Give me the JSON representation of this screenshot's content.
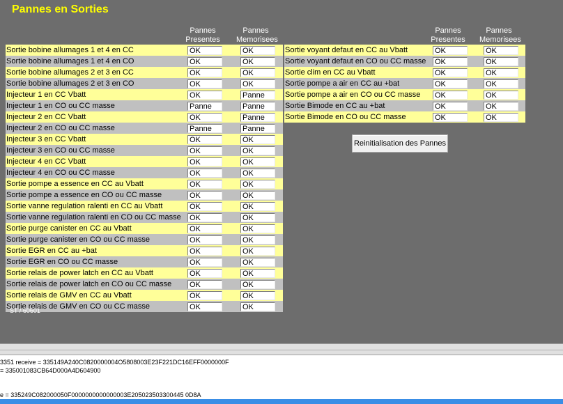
{
  "title": "Pannes en Sorties",
  "headers": {
    "present": [
      "Pannes",
      "Presentes"
    ],
    "memorised": [
      "Pannes",
      "Memorisees"
    ]
  },
  "colors": {
    "label_yellow": "#ffff99",
    "label_gray": "#c0c0c0",
    "title": "#ffff00"
  },
  "left_rows": [
    {
      "label": "Sortie bobine allumages 1 et 4 en CC",
      "present": "OK",
      "memorised": "OK"
    },
    {
      "label": "Sortie bobine allumages 1 et 4 en CO",
      "present": "OK",
      "memorised": "OK"
    },
    {
      "label": "Sortie bobine allumages 2 et 3 en CC",
      "present": "OK",
      "memorised": "OK"
    },
    {
      "label": "Sortie bobine allumages 2 et 3 en CO",
      "present": "OK",
      "memorised": "OK"
    },
    {
      "label": "Injecteur 1 en CC Vbatt",
      "present": "OK",
      "memorised": "Panne"
    },
    {
      "label": "Injecteur 1 en CO ou CC masse",
      "present": "Panne",
      "memorised": "Panne"
    },
    {
      "label": "Injecteur 2 en CC Vbatt",
      "present": "OK",
      "memorised": "Panne"
    },
    {
      "label": "Injecteur 2 en CO ou CC masse",
      "present": "Panne",
      "memorised": "Panne"
    },
    {
      "label": "Injecteur 3 en CC Vbatt",
      "present": "OK",
      "memorised": "OK"
    },
    {
      "label": "Injecteur 3 en CO ou CC masse",
      "present": "OK",
      "memorised": "OK"
    },
    {
      "label": "Injecteur 4 en CC Vbatt",
      "present": "OK",
      "memorised": "OK"
    },
    {
      "label": "Injecteur 4 en CO ou CC masse",
      "present": "OK",
      "memorised": "OK"
    },
    {
      "label": "Sortie pompe a essence en CC au Vbatt",
      "present": "OK",
      "memorised": "OK"
    },
    {
      "label": "Sortie pompe a essence en CO ou CC masse",
      "present": "OK",
      "memorised": "OK"
    },
    {
      "label": "Sortie vanne regulation ralenti en CC au Vbatt",
      "present": "OK",
      "memorised": "OK"
    },
    {
      "label": "Sortie vanne regulation ralenti en CO ou CC masse",
      "present": "OK",
      "memorised": "OK"
    },
    {
      "label": "Sortie purge canister en CC au Vbatt",
      "present": "OK",
      "memorised": "OK"
    },
    {
      "label": "Sortie purge canister en CO ou CC masse",
      "present": "OK",
      "memorised": "OK"
    },
    {
      "label": "Sortie EGR en CC au +bat",
      "present": "OK",
      "memorised": "OK"
    },
    {
      "label": "Sortie EGR en CO ou CC masse",
      "present": "OK",
      "memorised": "OK"
    },
    {
      "label": "Sortie relais de power latch en CC au Vbatt",
      "present": "OK",
      "memorised": "OK"
    },
    {
      "label": "Sortie relais de power latch en CO ou CC masse",
      "present": "OK",
      "memorised": "OK"
    },
    {
      "label": "Sortie relais de GMV en CC au Vbatt",
      "present": "OK",
      "memorised": "OK"
    },
    {
      "label": "Sortie relais de GMV en CO ou CC masse",
      "present": "OK",
      "memorised": "OK"
    }
  ],
  "right_rows": [
    {
      "label": "Sortie voyant defaut en CC au Vbatt",
      "present": "OK",
      "memorised": "OK"
    },
    {
      "label": "Sortie voyant defaut en CO ou CC masse",
      "present": "OK",
      "memorised": "OK"
    },
    {
      "label": "Sortie clim en CC au Vbatt",
      "present": "OK",
      "memorised": "OK"
    },
    {
      "label": "Sortie pompe a air en CC au +bat",
      "present": "OK",
      "memorised": "OK"
    },
    {
      "label": "Sortie pompe a air en CO ou CC masse",
      "present": "OK",
      "memorised": "OK"
    },
    {
      "label": "Sortie Bimode en CC au +bat",
      "present": "OK",
      "memorised": "OK"
    },
    {
      "label": "Sortie Bimode en CO ou CC masse",
      "present": "OK",
      "memorised": "OK"
    }
  ],
  "reset_button": "Reinitialisation des Pannes",
  "module_id": "ST / 60601",
  "log_lines": [
    "3351 receive = 335149A240C0820000004O5808003E23F221DC16EFF0000000F",
    "= 335001083CB64D000A4D604900",
    "",
    "e = 335249C082000050F0000000000000003E205023503300445 0D8A"
  ]
}
